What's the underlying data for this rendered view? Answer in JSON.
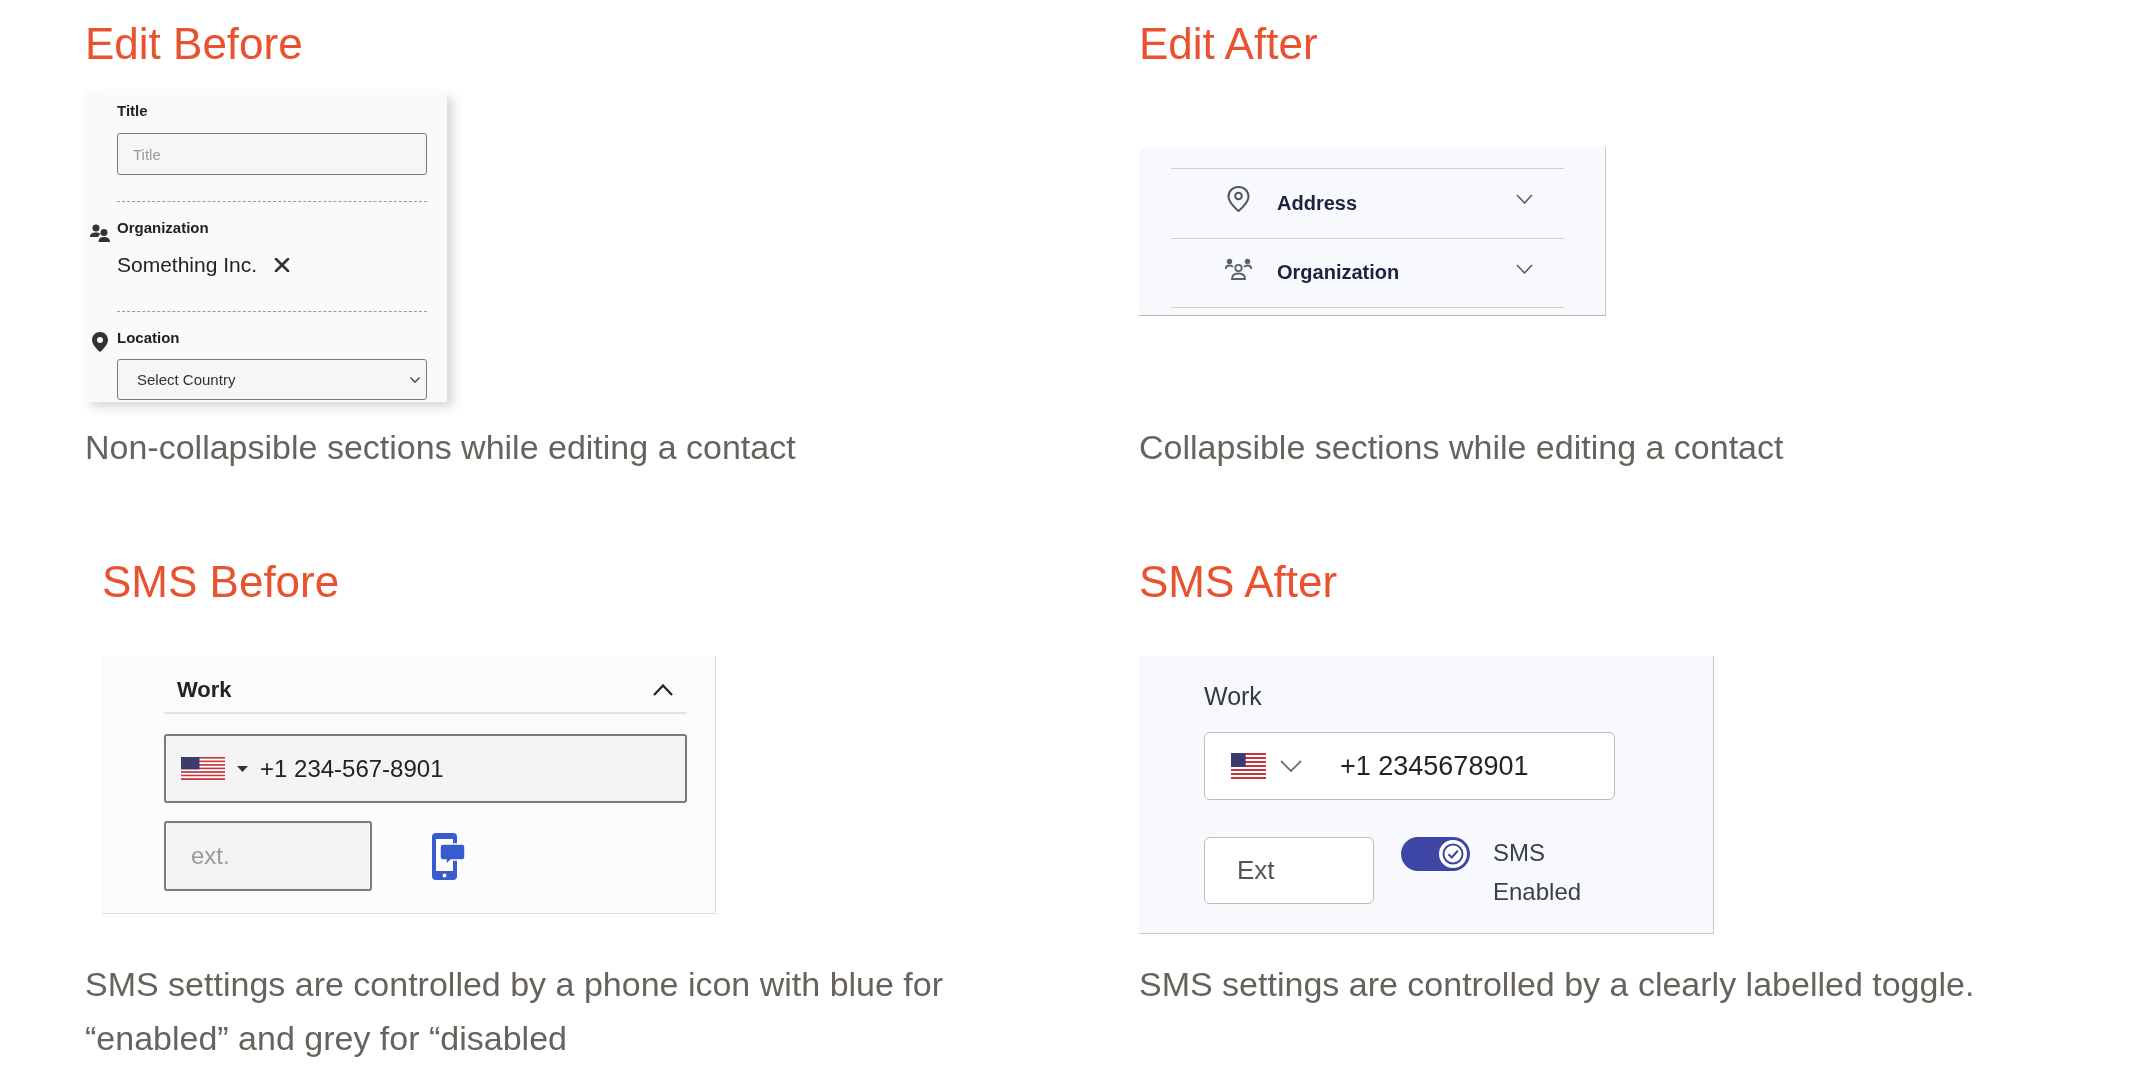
{
  "panels": [
    {
      "kind": "edit_before",
      "heading": "Edit Before",
      "fields": [
        {
          "kind": "text",
          "label": "Title",
          "placeholder": "Title"
        },
        {
          "kind": "tag",
          "label": "Organization",
          "value": "Something Inc."
        },
        {
          "kind": "select",
          "label": "Location",
          "value": "Select Country"
        }
      ],
      "caption": "Non-collapsible sections while editing a contact"
    },
    {
      "kind": "edit_after",
      "heading": "Edit After",
      "sections": [
        {
          "label": "Address",
          "expanded": false
        },
        {
          "label": "Organization",
          "expanded": false
        }
      ],
      "caption": "Collapsible sections while editing a contact"
    },
    {
      "kind": "sms_before",
      "heading": "SMS Before",
      "section": {
        "label": "Work",
        "expanded": true
      },
      "phone": "+1 234-567-8901",
      "extension_placeholder": "ext.",
      "sms_enabled": true,
      "caption": "SMS settings are controlled by a phone icon with blue for “enabled” and grey for “disabled"
    },
    {
      "kind": "sms_after",
      "heading": "SMS After",
      "label": "Work",
      "phone": "+1 2345678901",
      "extension_placeholder": "Ext",
      "sms_toggle": {
        "label": "SMS Enabled",
        "on": true
      },
      "caption": "SMS settings are controlled by a clearly labelled toggle."
    }
  ]
}
